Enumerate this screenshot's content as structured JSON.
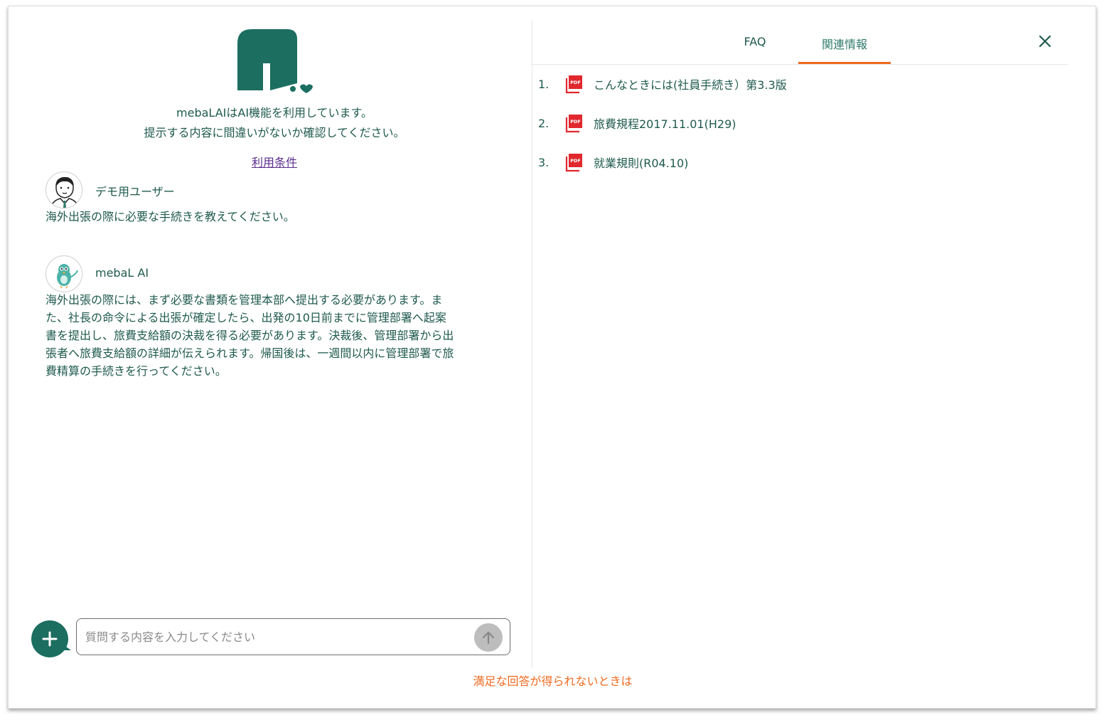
{
  "notice": {
    "line1": "mebaLAIはAI機能を利用しています。",
    "line2": "提示する内容に間違いがないか確認してください。",
    "terms_link": "利用条件"
  },
  "conversation": {
    "user": {
      "name": "デモ用ユーザー",
      "message": "海外出張の際に必要な手続きを教えてください。"
    },
    "assistant": {
      "name": "mebaL AI",
      "message_lines": [
        "海外出張の際には、まず必要な書類を管理本部へ提出する必要があります。ま",
        "た、社長の命令による出張が確定したら、出発の10日前までに管理部署へ起案",
        "書を提出し、旅費支給額の決裁を得る必要があります。決裁後、管理部署から出",
        "張者へ旅費支給額の詳細が伝えられます。帰国後は、一週間以内に管理部署で旅",
        "費精算の手続きを行ってください。"
      ]
    }
  },
  "input": {
    "placeholder": "質問する内容を入力してください",
    "value": ""
  },
  "footer": {
    "unsatisfied_link": "満足な回答が得られないときは"
  },
  "side_panel": {
    "tabs": [
      {
        "label": "FAQ",
        "active": false
      },
      {
        "label": "関連情報",
        "active": true
      }
    ],
    "documents": [
      {
        "number": "1.",
        "title": "こんなときには(社員手続き）第3.3版",
        "icon": "pdf-icon"
      },
      {
        "number": "2.",
        "title": "旅費規程2017.11.01(H29)",
        "icon": "pdf-icon"
      },
      {
        "number": "3.",
        "title": "就業規則(R04.10)",
        "icon": "pdf-icon"
      }
    ]
  },
  "colors": {
    "brand_green": "#1b6e60",
    "text_green": "#1f5a4d",
    "accent_orange": "#ee6a1f",
    "link_purple": "#5b2d8f",
    "pdf_red": "#e0282e"
  }
}
